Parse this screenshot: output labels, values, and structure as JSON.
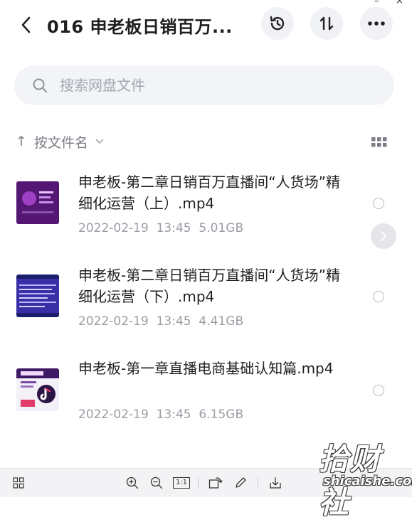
{
  "window": {
    "minimize": "–",
    "close": "×"
  },
  "header": {
    "title": "016 申老板日销百万..."
  },
  "search": {
    "placeholder": "搜索网盘文件"
  },
  "sort": {
    "arrow": "↑",
    "label": "按文件名"
  },
  "files": [
    {
      "name": "申老板-第二章日销百万直播间“人货场”精细化运营（上）.mp4",
      "date": "2022-02-19  13:45",
      "size": "5.01GB",
      "thumb_icon": "video-thumbnail-icon"
    },
    {
      "name": "申老板-第二章日销百万直播间“人货场”精细化运营（下）.mp4",
      "date": "2022-02-19  13:45",
      "size": "4.41GB",
      "thumb_icon": "video-thumbnail-icon"
    },
    {
      "name": "申老板-第一章直播电商基础认知篇.mp4",
      "date": "2022-02-19  13:45",
      "size": "6.15GB",
      "thumb_icon": "video-thumbnail-icon"
    }
  ],
  "toolbar": {
    "actual_size": "1:1"
  },
  "watermark": {
    "text": "拾财社",
    "url": "shicaishe.com"
  },
  "colors": {
    "accent": "#1f1f1f",
    "muted": "#9a9da4",
    "search_bg": "#f2f4f8",
    "button_bg": "#f1f2f6"
  }
}
